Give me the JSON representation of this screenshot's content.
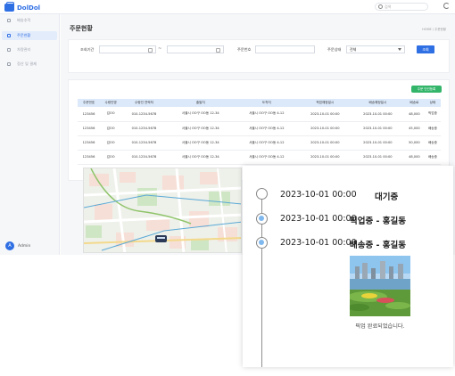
{
  "app": {
    "name": "DolDol"
  },
  "topbar": {
    "search_placeholder": "검색"
  },
  "sidebar": {
    "items": [
      {
        "label": "배송추적"
      },
      {
        "label": "주문현황"
      },
      {
        "label": "차량관리"
      },
      {
        "label": "정산 및 결제"
      }
    ],
    "user": {
      "initial": "A",
      "name": "Admin"
    }
  },
  "page": {
    "title": "주문현황",
    "breadcrumb": "HOME / 주문현황"
  },
  "filter": {
    "period_label": "조회기간",
    "period_separator": "~",
    "order_no_label": "주문번호",
    "status_label": "주문상태",
    "status_value": "전체",
    "search_button": "조회"
  },
  "table": {
    "add_button": "주문 단건등록",
    "columns": [
      "주문번호",
      "수령인명",
      "수령인 연락처",
      "출발지",
      "도착지",
      "픽업예정일시",
      "배송예정일시",
      "배송료",
      "상태"
    ],
    "rows": [
      [
        "123456",
        "김OO",
        "010-1234-5678",
        "서울시 OO구 OO동 12-34",
        "서울시 OO구 OO동 4-12",
        "2023-10-01 00:00",
        "2023-10-01 00:00",
        "48,000",
        "픽업중"
      ],
      [
        "123456",
        "김OO",
        "010-1234-5678",
        "서울시 OO구 OO동 12-34",
        "서울시 OO구 OO동 4-12",
        "2023-10-01 00:00",
        "2023-10-01 00:00",
        "45,000",
        "배송중"
      ],
      [
        "123456",
        "김OO",
        "010-1234-5678",
        "서울시 OO구 OO동 12-34",
        "서울시 OO구 OO동 4-12",
        "2023-10-01 00:00",
        "2023-10-01 00:00",
        "50,000",
        "배송중"
      ],
      [
        "123456",
        "김OO",
        "010-1234-5678",
        "서울시 OO구 OO동 12-34",
        "서울시 OO구 OO동 4-12",
        "2023-10-01 00:00",
        "2023-10-01 00:00",
        "48,000",
        "배송중"
      ]
    ]
  },
  "tracking": {
    "events": [
      {
        "time": "2023-10-01 00:00",
        "status": "대기중",
        "state": "pending"
      },
      {
        "time": "2023-10-01 00:00",
        "status": "픽업중 - 홍길동",
        "state": "done"
      },
      {
        "time": "2023-10-01 00:00",
        "status": "배송중 - 홍길동",
        "state": "done"
      }
    ],
    "photo_caption": "픽업 완료되었습니다."
  },
  "colors": {
    "brand": "#2f6fe4",
    "success": "#33b56a",
    "table_header": "#dce9fa",
    "timeline_dot": "#7fb8ee"
  }
}
